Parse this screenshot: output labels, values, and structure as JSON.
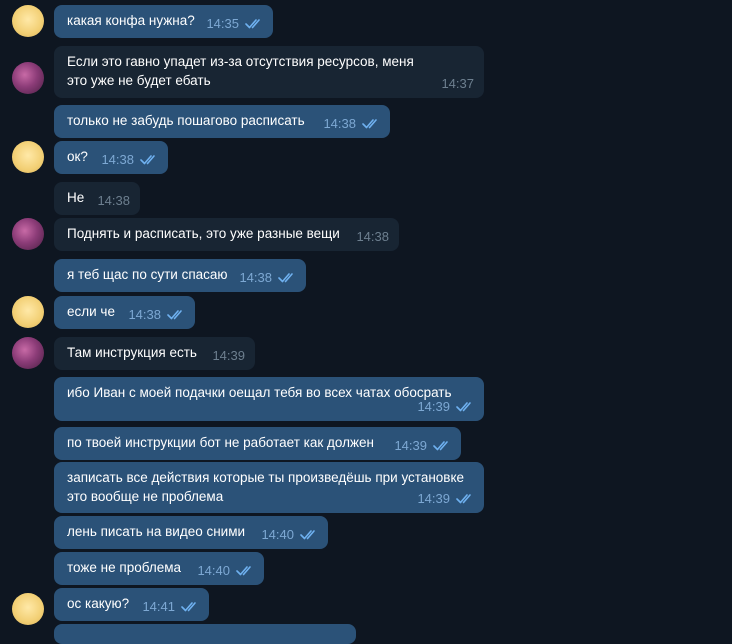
{
  "messages": [
    {
      "text": "какая конфа нужна?",
      "time": "14:35"
    },
    {
      "text": "Если это гавно упадет из-за отсутствия ресурсов, меня это уже не будет ебать",
      "time": "14:37"
    },
    {
      "text": "только не забудь пошагово расписать",
      "time": "14:38"
    },
    {
      "text": "ок?",
      "time": "14:38"
    },
    {
      "text": "Не",
      "time": "14:38"
    },
    {
      "text": "Поднять и расписать, это уже разные вещи",
      "time": "14:38"
    },
    {
      "text": "я теб щас по сути спасаю",
      "time": "14:38"
    },
    {
      "text": "если че",
      "time": "14:38"
    },
    {
      "text": "Там инструкция есть",
      "time": "14:39"
    },
    {
      "text": "ибо Иван с моей подачки оещал тебя во всех чатах обосрать",
      "time": "14:39"
    },
    {
      "text": "по твоей инструкции бот не работает как должен",
      "time": "14:39"
    },
    {
      "text": "записать все действия которые ты произведёшь при установке это вообще не проблема",
      "time": "14:39"
    },
    {
      "text": "лень писать на видео сними",
      "time": "14:40"
    },
    {
      "text": "тоже не проблема",
      "time": "14:40"
    },
    {
      "text": "ос какую?",
      "time": "14:41"
    }
  ],
  "colors": {
    "background": "#0e1621",
    "outgoing_bubble": "#2b5278",
    "incoming_bubble": "#182533",
    "outgoing_time": "#7da8d3",
    "incoming_time": "#6d7f8f"
  },
  "icons": {
    "read_receipt": "double-check-icon"
  }
}
